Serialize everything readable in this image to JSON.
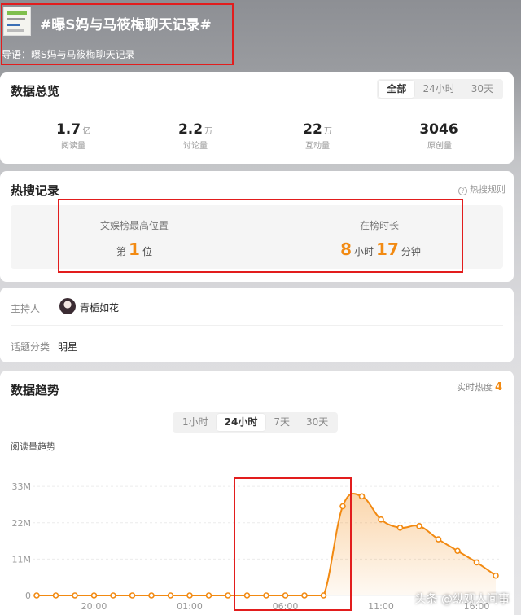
{
  "topic": {
    "title": "#曝S妈与马筱梅聊天记录#",
    "guide": "导语：曝S妈与马筱梅聊天记录"
  },
  "overview": {
    "title": "数据总览",
    "tabs": [
      "全部",
      "24小时",
      "30天"
    ],
    "active_tab": "全部",
    "stats": [
      {
        "value": "1.7",
        "unit": "亿",
        "label": "阅读量"
      },
      {
        "value": "2.2",
        "unit": "万",
        "label": "讨论量"
      },
      {
        "value": "22",
        "unit": "万",
        "label": "互动量"
      },
      {
        "value": "3046",
        "unit": "",
        "label": "原创量"
      }
    ]
  },
  "hot_search": {
    "title": "热搜记录",
    "rules_label": "热搜规则",
    "highest_label": "文娱榜最高位置",
    "highest_prefix": "第",
    "highest_value": "1",
    "highest_suffix": "位",
    "duration_label": "在榜时长",
    "duration_hours": "8",
    "hours_unit": "小时",
    "duration_minutes": "17",
    "minutes_unit": "分钟"
  },
  "info": {
    "host_label": "主持人",
    "host_name": "青栀如花",
    "category_label": "话题分类",
    "category": "明星"
  },
  "trend": {
    "title": "数据趋势",
    "realtime_label": "实时热度",
    "realtime_value": "4",
    "tabs": [
      "1小时",
      "24小时",
      "7天",
      "30天"
    ],
    "active_tab": "24小时",
    "chart_subtitle": "阅读量趋势"
  },
  "chart_data": {
    "type": "area",
    "title": "阅读量趋势",
    "y_ticks": [
      "0",
      "11M",
      "22M",
      "33M"
    ],
    "x_ticks": [
      "20:00",
      "01:00",
      "06:00",
      "11:00",
      "16:00"
    ],
    "y_max": 36,
    "series": [
      {
        "values": [
          0,
          0,
          0,
          0,
          0,
          0,
          0,
          0,
          0,
          0,
          0,
          0,
          0,
          0,
          0,
          0,
          27,
          30,
          23,
          20.5,
          21,
          17,
          13.5,
          10,
          6
        ]
      }
    ],
    "color": "#f28a12"
  },
  "watermark": "头条 @纵观人间事"
}
